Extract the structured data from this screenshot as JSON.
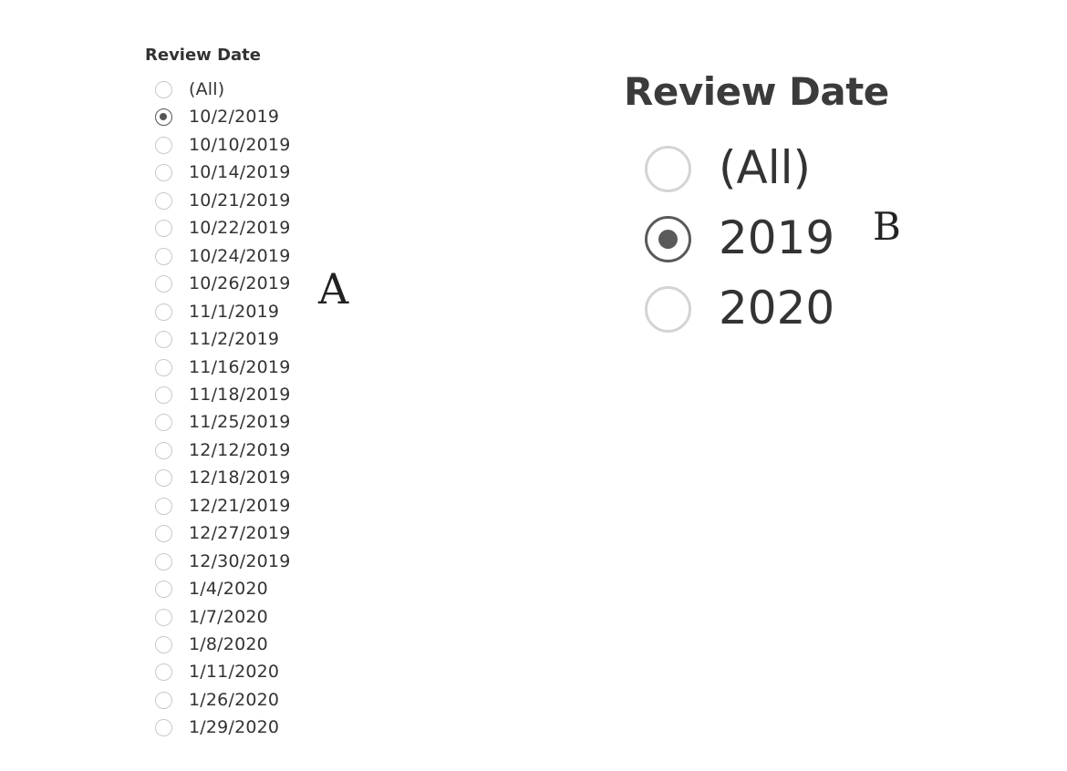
{
  "panel_a": {
    "title": "Review Date",
    "marker": "A",
    "options": [
      {
        "label": "(All)",
        "checked": false
      },
      {
        "label": "10/2/2019",
        "checked": true
      },
      {
        "label": "10/10/2019",
        "checked": false
      },
      {
        "label": "10/14/2019",
        "checked": false
      },
      {
        "label": "10/21/2019",
        "checked": false
      },
      {
        "label": "10/22/2019",
        "checked": false
      },
      {
        "label": "10/24/2019",
        "checked": false
      },
      {
        "label": "10/26/2019",
        "checked": false
      },
      {
        "label": "11/1/2019",
        "checked": false
      },
      {
        "label": "11/2/2019",
        "checked": false
      },
      {
        "label": "11/16/2019",
        "checked": false
      },
      {
        "label": "11/18/2019",
        "checked": false
      },
      {
        "label": "11/25/2019",
        "checked": false
      },
      {
        "label": "12/12/2019",
        "checked": false
      },
      {
        "label": "12/18/2019",
        "checked": false
      },
      {
        "label": "12/21/2019",
        "checked": false
      },
      {
        "label": "12/27/2019",
        "checked": false
      },
      {
        "label": "12/30/2019",
        "checked": false
      },
      {
        "label": "1/4/2020",
        "checked": false
      },
      {
        "label": "1/7/2020",
        "checked": false
      },
      {
        "label": "1/8/2020",
        "checked": false
      },
      {
        "label": "1/11/2020",
        "checked": false
      },
      {
        "label": "1/26/2020",
        "checked": false
      },
      {
        "label": "1/29/2020",
        "checked": false
      }
    ]
  },
  "panel_b": {
    "title": "Review Date",
    "marker": "B",
    "options": [
      {
        "label": "(All)",
        "checked": false
      },
      {
        "label": "2019",
        "checked": true
      },
      {
        "label": "2020",
        "checked": false
      }
    ]
  }
}
